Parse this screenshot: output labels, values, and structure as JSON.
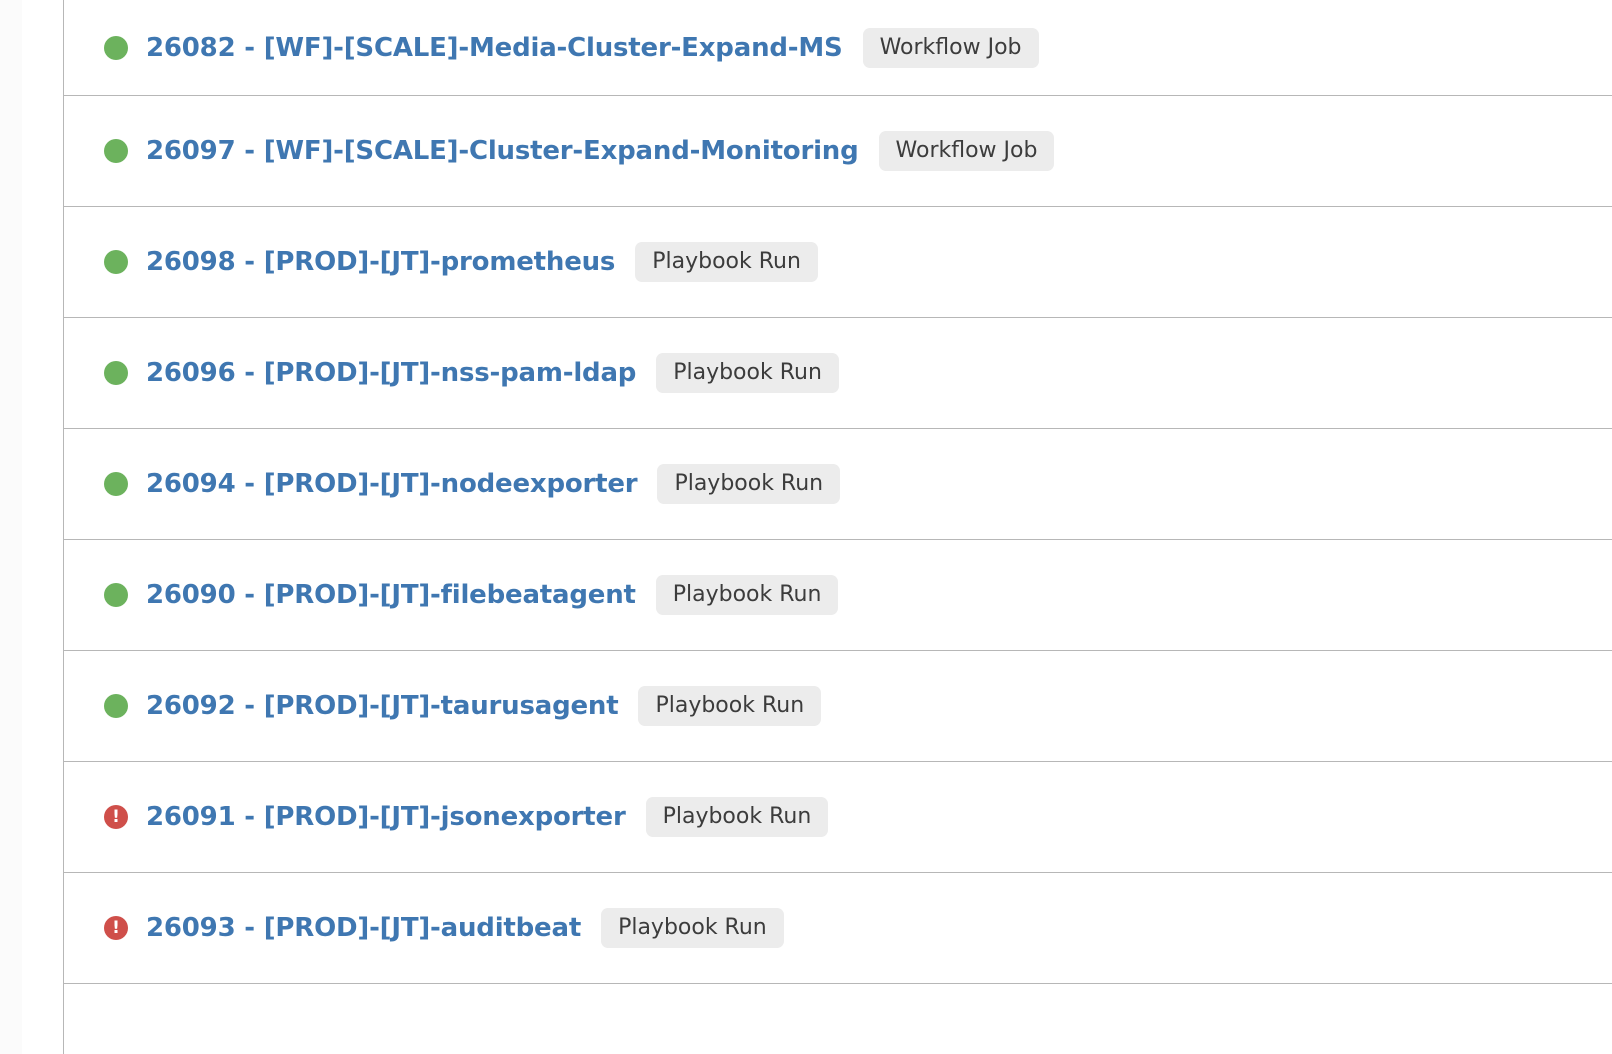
{
  "colors": {
    "link": "#3f77b1",
    "success": "#6cb25d",
    "failed": "#cf4f4a",
    "badge_bg": "#ececec",
    "divider": "#b7b7b7"
  },
  "jobs": [
    {
      "title": "26082 - [WF]-[SCALE]-Media-Cluster-Expand-MS",
      "type": "Workflow Job",
      "status": "success",
      "status_icon": "success-circle-icon"
    },
    {
      "title": "26097 - [WF]-[SCALE]-Cluster-Expand-Monitoring",
      "type": "Workflow Job",
      "status": "success",
      "status_icon": "success-circle-icon"
    },
    {
      "title": "26098 - [PROD]-[JT]-prometheus",
      "type": "Playbook Run",
      "status": "success",
      "status_icon": "success-circle-icon"
    },
    {
      "title": "26096 - [PROD]-[JT]-nss-pam-ldap",
      "type": "Playbook Run",
      "status": "success",
      "status_icon": "success-circle-icon"
    },
    {
      "title": "26094 - [PROD]-[JT]-nodeexporter",
      "type": "Playbook Run",
      "status": "success",
      "status_icon": "success-circle-icon"
    },
    {
      "title": "26090 - [PROD]-[JT]-filebeatagent",
      "type": "Playbook Run",
      "status": "success",
      "status_icon": "success-circle-icon"
    },
    {
      "title": "26092 - [PROD]-[JT]-taurusagent",
      "type": "Playbook Run",
      "status": "success",
      "status_icon": "success-circle-icon"
    },
    {
      "title": "26091 - [PROD]-[JT]-jsonexporter",
      "type": "Playbook Run",
      "status": "failed",
      "status_icon": "error-exclamation-icon"
    },
    {
      "title": "26093 - [PROD]-[JT]-auditbeat",
      "type": "Playbook Run",
      "status": "failed",
      "status_icon": "error-exclamation-icon"
    }
  ]
}
